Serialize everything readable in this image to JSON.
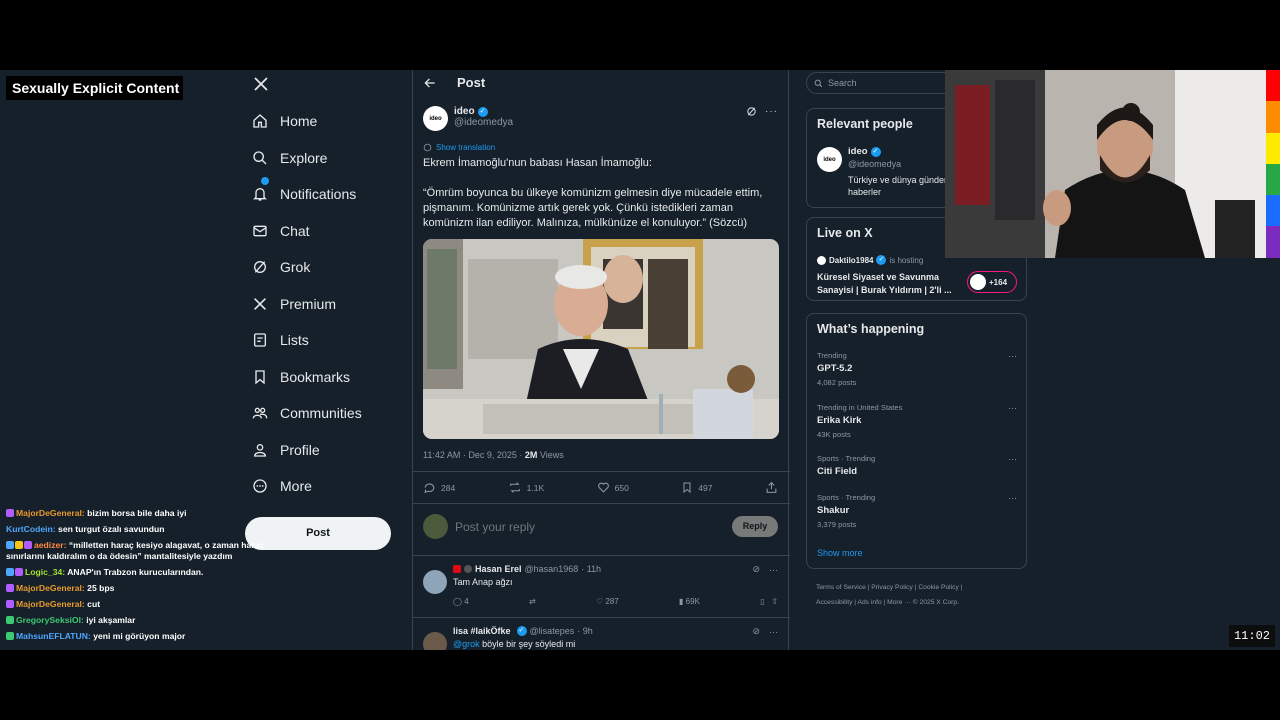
{
  "overlay": {
    "content_warning": "Sexually Explicit Content",
    "clock": "11:02",
    "rainbow_colors": [
      "#ff0000",
      "#ff8c00",
      "#ffeb00",
      "#28a745",
      "#1a6bff",
      "#7b2cbf"
    ]
  },
  "nav": {
    "items": [
      {
        "label": "Home",
        "icon": "home-icon"
      },
      {
        "label": "Explore",
        "icon": "search-icon"
      },
      {
        "label": "Notifications",
        "icon": "bell-icon"
      },
      {
        "label": "Chat",
        "icon": "mail-icon"
      },
      {
        "label": "Grok",
        "icon": "grok-icon"
      },
      {
        "label": "Premium",
        "icon": "x-logo-icon"
      },
      {
        "label": "Lists",
        "icon": "list-icon"
      },
      {
        "label": "Bookmarks",
        "icon": "bookmark-icon"
      },
      {
        "label": "Communities",
        "icon": "people-icon"
      },
      {
        "label": "Profile",
        "icon": "person-icon"
      },
      {
        "label": "More",
        "icon": "more-circle-icon"
      }
    ],
    "post_button": "Post"
  },
  "chat": [
    {
      "user": "MajorDeGeneral:",
      "color": "#e99a2b",
      "msg": "bizim borsa bile daha iyi"
    },
    {
      "user": "KurtCodein:",
      "color": "#4fa6ff",
      "msg": "sen turgut özalı savundun"
    },
    {
      "user": "aedizer:",
      "color": "#ff8a3d",
      "msg": "“milletten haraç kesiyo alagavat, o zaman haraç sınırlarını kaldıralım o da ödesin” mantalitesiyle yazdım"
    },
    {
      "user": "Logic_34:",
      "color": "#a6e22e",
      "msg": "ANAP'ın Trabzon kurucularından."
    },
    {
      "user": "MajorDeGeneral:",
      "color": "#e99a2b",
      "msg": "25 bps"
    },
    {
      "user": "MajorDeGeneral:",
      "color": "#e99a2b",
      "msg": "cut"
    },
    {
      "user": "GregorySeksiOl:",
      "color": "#3dc96f",
      "msg": "iyi akşamlar"
    },
    {
      "user": "MahsunEFLATUN:",
      "color": "#4fa6ff",
      "msg": "yeni mi görüyon major"
    }
  ],
  "main": {
    "header_title": "Post",
    "author": {
      "name": "ideo",
      "handle": "@ideomedya",
      "avatar_text": "ideo"
    },
    "show_translation": "Show translation",
    "text_line1": "Ekrem İmamoğlu'nun babası Hasan İmamoğlu:",
    "text_line2": "“Ömrüm boyunca bu ülkeye komünizm gelmesin diye mücadele ettim, pişmanım. Komünizme artık gerek yok. Çünkü istedikleri zaman komünizm ilan ediliyor. Malınıza, mülkünüze el konuluyor.” (Sözcü)",
    "timestamp": "11:42 AM · Dec 9, 2025 · ",
    "views_count": "2M",
    "views_label": " Views",
    "stats": {
      "replies": "284",
      "reposts": "1.1K",
      "likes": "650",
      "bookmarks": "497"
    },
    "reply_placeholder": "Post your reply",
    "reply_button": "Reply",
    "comments": [
      {
        "name": "Hasan Erel",
        "handle": "@hasan1968",
        "time": "· 11h",
        "text": "Tam Anap ağzı",
        "replies": "4",
        "likes": "287",
        "views": "69K"
      },
      {
        "name": "lisa #laikÖfke",
        "handle": "@lisatepes",
        "time": "· 9h",
        "mention": "@grok",
        "text": " böyle bir şey söyledi mi"
      }
    ]
  },
  "right": {
    "search_placeholder": "Search",
    "relevant": {
      "title": "Relevant people",
      "name": "ideo",
      "handle": "@ideomedya",
      "bio": "Türkiye ve dünya gündemi",
      "bio2": "haberler"
    },
    "live": {
      "title": "Live on X",
      "host": "Daktilo1984",
      "hosting": "is hosting",
      "topic": "Küresel Siyaset ve Savunma",
      "topic2": "Sanayisi | Burak Yıldırım | 2'li ...",
      "listeners": "+164"
    },
    "happening": {
      "title": "What’s happening",
      "trends": [
        {
          "meta": "Trending",
          "name": "GPT-5.2",
          "count": "4,082 posts"
        },
        {
          "meta": "Trending in United States",
          "name": "Erika Kirk",
          "count": "43K posts"
        },
        {
          "meta": "Sports · Trending",
          "name": "Citi Field",
          "count": ""
        },
        {
          "meta": "Sports · Trending",
          "name": "Shakur",
          "count": "3,379 posts"
        }
      ],
      "show_more": "Show more"
    },
    "footer": {
      "line1": "Terms of Service  |   Privacy Policy  |   Cookie Policy  |",
      "line2": "Accessibility  |   Ads info  |   More ···   © 2025 X Corp."
    }
  }
}
